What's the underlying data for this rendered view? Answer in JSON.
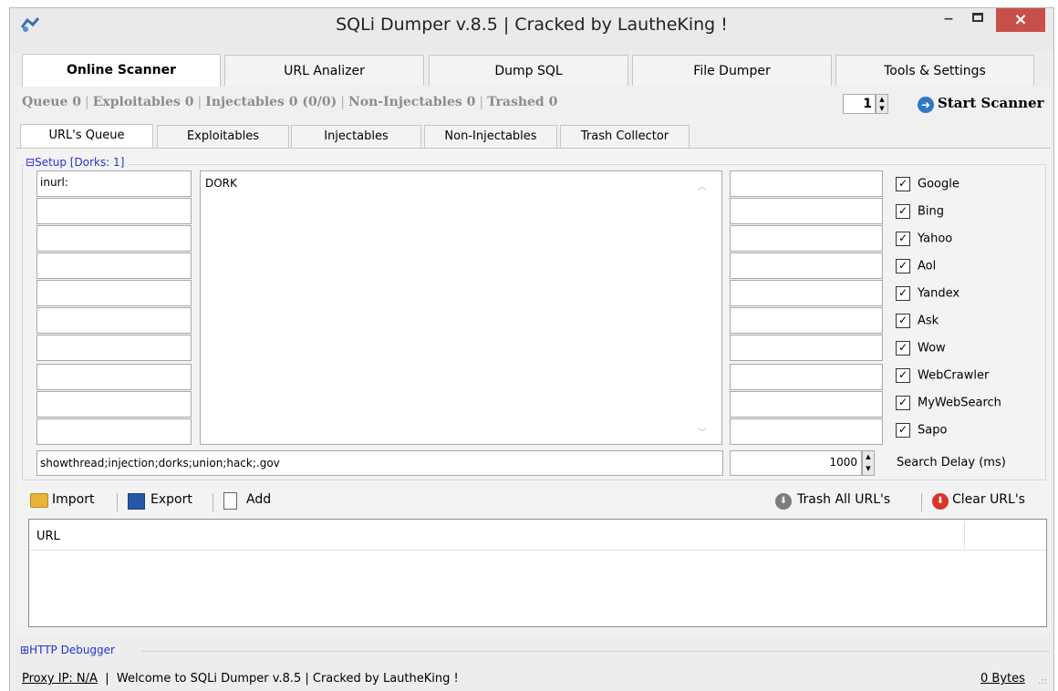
{
  "window": {
    "title": "SQLi Dumper v.8.5 | Cracked by LautheKing !",
    "minimize": "–",
    "close": "×"
  },
  "main_tabs": [
    "Online Scanner",
    "URL Analizer",
    "Dump SQL",
    "File Dumper",
    "Tools & Settings"
  ],
  "stats": {
    "queue": "Queue 0",
    "exploitables": "Exploitables 0",
    "injectables": "Injectables 0 (0/0)",
    "non_injectables": "Non-Injectables 0",
    "trashed": "Trashed 0"
  },
  "scanner": {
    "threads": "1",
    "start_label": "Start Scanner"
  },
  "sub_tabs": [
    "URL's Queue",
    "Exploitables",
    "Injectables",
    "Non-Injectables",
    "Trash Collector"
  ],
  "setup": {
    "label": "Setup [Dorks: 1]",
    "prefix_values": [
      "inurl:",
      "",
      "",
      "",
      "",
      "",
      "",
      "",
      "",
      ""
    ],
    "dork_text": "DORK",
    "keywords": "showthread;injection;dorks;union;hack;.gov",
    "search_delay": "1000",
    "search_delay_label": "Search Delay (ms)"
  },
  "engines": [
    {
      "name": "Google",
      "checked": true
    },
    {
      "name": "Bing",
      "checked": true
    },
    {
      "name": "Yahoo",
      "checked": true
    },
    {
      "name": "Aol",
      "checked": true
    },
    {
      "name": "Yandex",
      "checked": true
    },
    {
      "name": "Ask",
      "checked": true
    },
    {
      "name": "Wow",
      "checked": true
    },
    {
      "name": "WebCrawler",
      "checked": true
    },
    {
      "name": "MyWebSearch",
      "checked": true
    },
    {
      "name": "Sapo",
      "checked": true
    }
  ],
  "toolbar": {
    "import": "Import",
    "export": "Export",
    "add": "Add",
    "trash_all": "Trash All URL's",
    "clear": "Clear URL's"
  },
  "grid": {
    "column_url": "URL"
  },
  "debugger": {
    "label": "HTTP Debugger"
  },
  "status": {
    "proxy": "Proxy IP: N/A",
    "message": "Welcome to SQLi Dumper v.8.5 | Cracked by LautheKing !",
    "bytes": "0 Bytes"
  }
}
